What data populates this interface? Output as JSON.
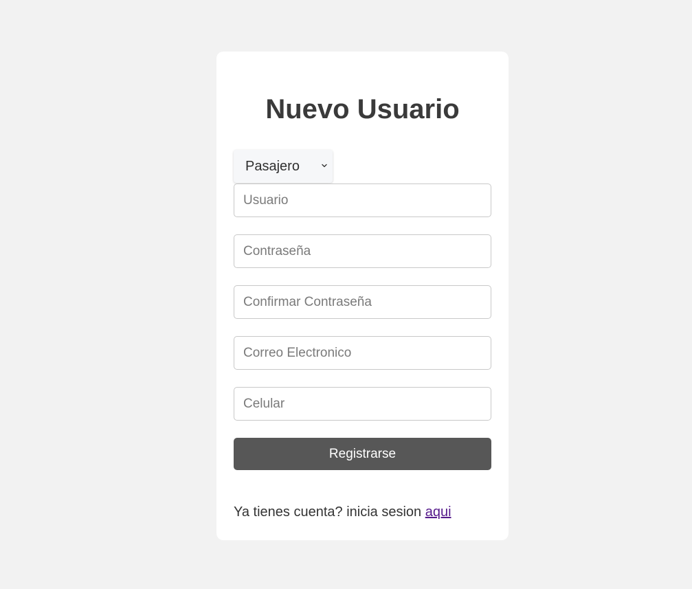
{
  "form": {
    "title": "Nuevo Usuario",
    "role_select": {
      "selected": "Pasajero"
    },
    "fields": {
      "username_placeholder": "Usuario",
      "password_placeholder": "Contraseña",
      "confirm_password_placeholder": "Confirmar Contraseña",
      "email_placeholder": "Correo Electronico",
      "phone_placeholder": "Celular"
    },
    "submit_label": "Registrarse",
    "footer": {
      "text": "Ya tienes cuenta? inicia sesion",
      "link_label": "aqui"
    }
  },
  "colors": {
    "page_background": "#f2f2f2",
    "card_background": "#ffffff",
    "button_background": "#575757",
    "visited_link": "#551a8b"
  },
  "icons": {
    "select_arrow": "chevron-down-icon"
  }
}
